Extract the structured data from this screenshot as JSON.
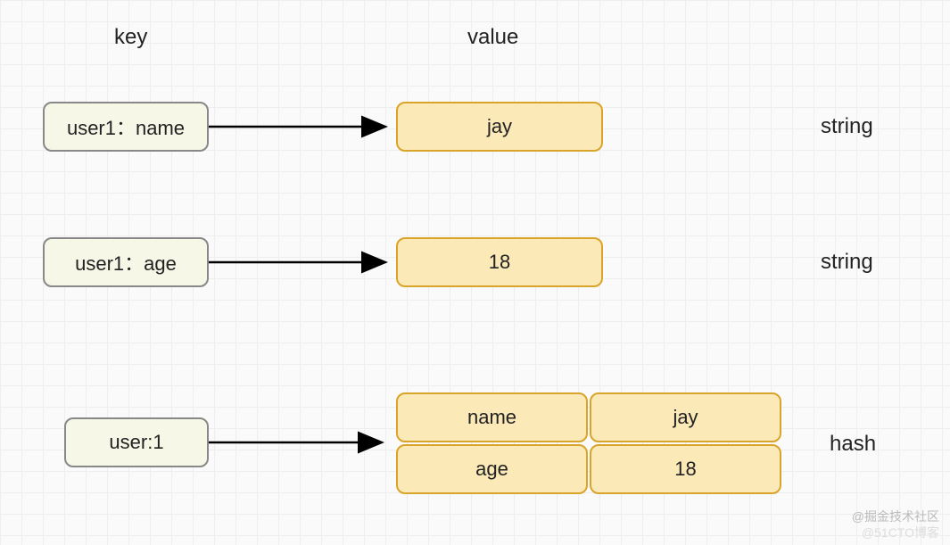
{
  "headers": {
    "key": "key",
    "value": "value"
  },
  "rows": [
    {
      "key": "user1：name",
      "value": "jay",
      "type": "string"
    },
    {
      "key": "user1：age",
      "value": "18",
      "type": "string"
    },
    {
      "key": "user:1",
      "type": "hash",
      "cells": {
        "name_label": "name",
        "name_value": "jay",
        "age_label": "age",
        "age_value": "18"
      }
    }
  ],
  "watermarks": {
    "main": "@掘金技术社区",
    "sub": "@51CTO博客"
  }
}
